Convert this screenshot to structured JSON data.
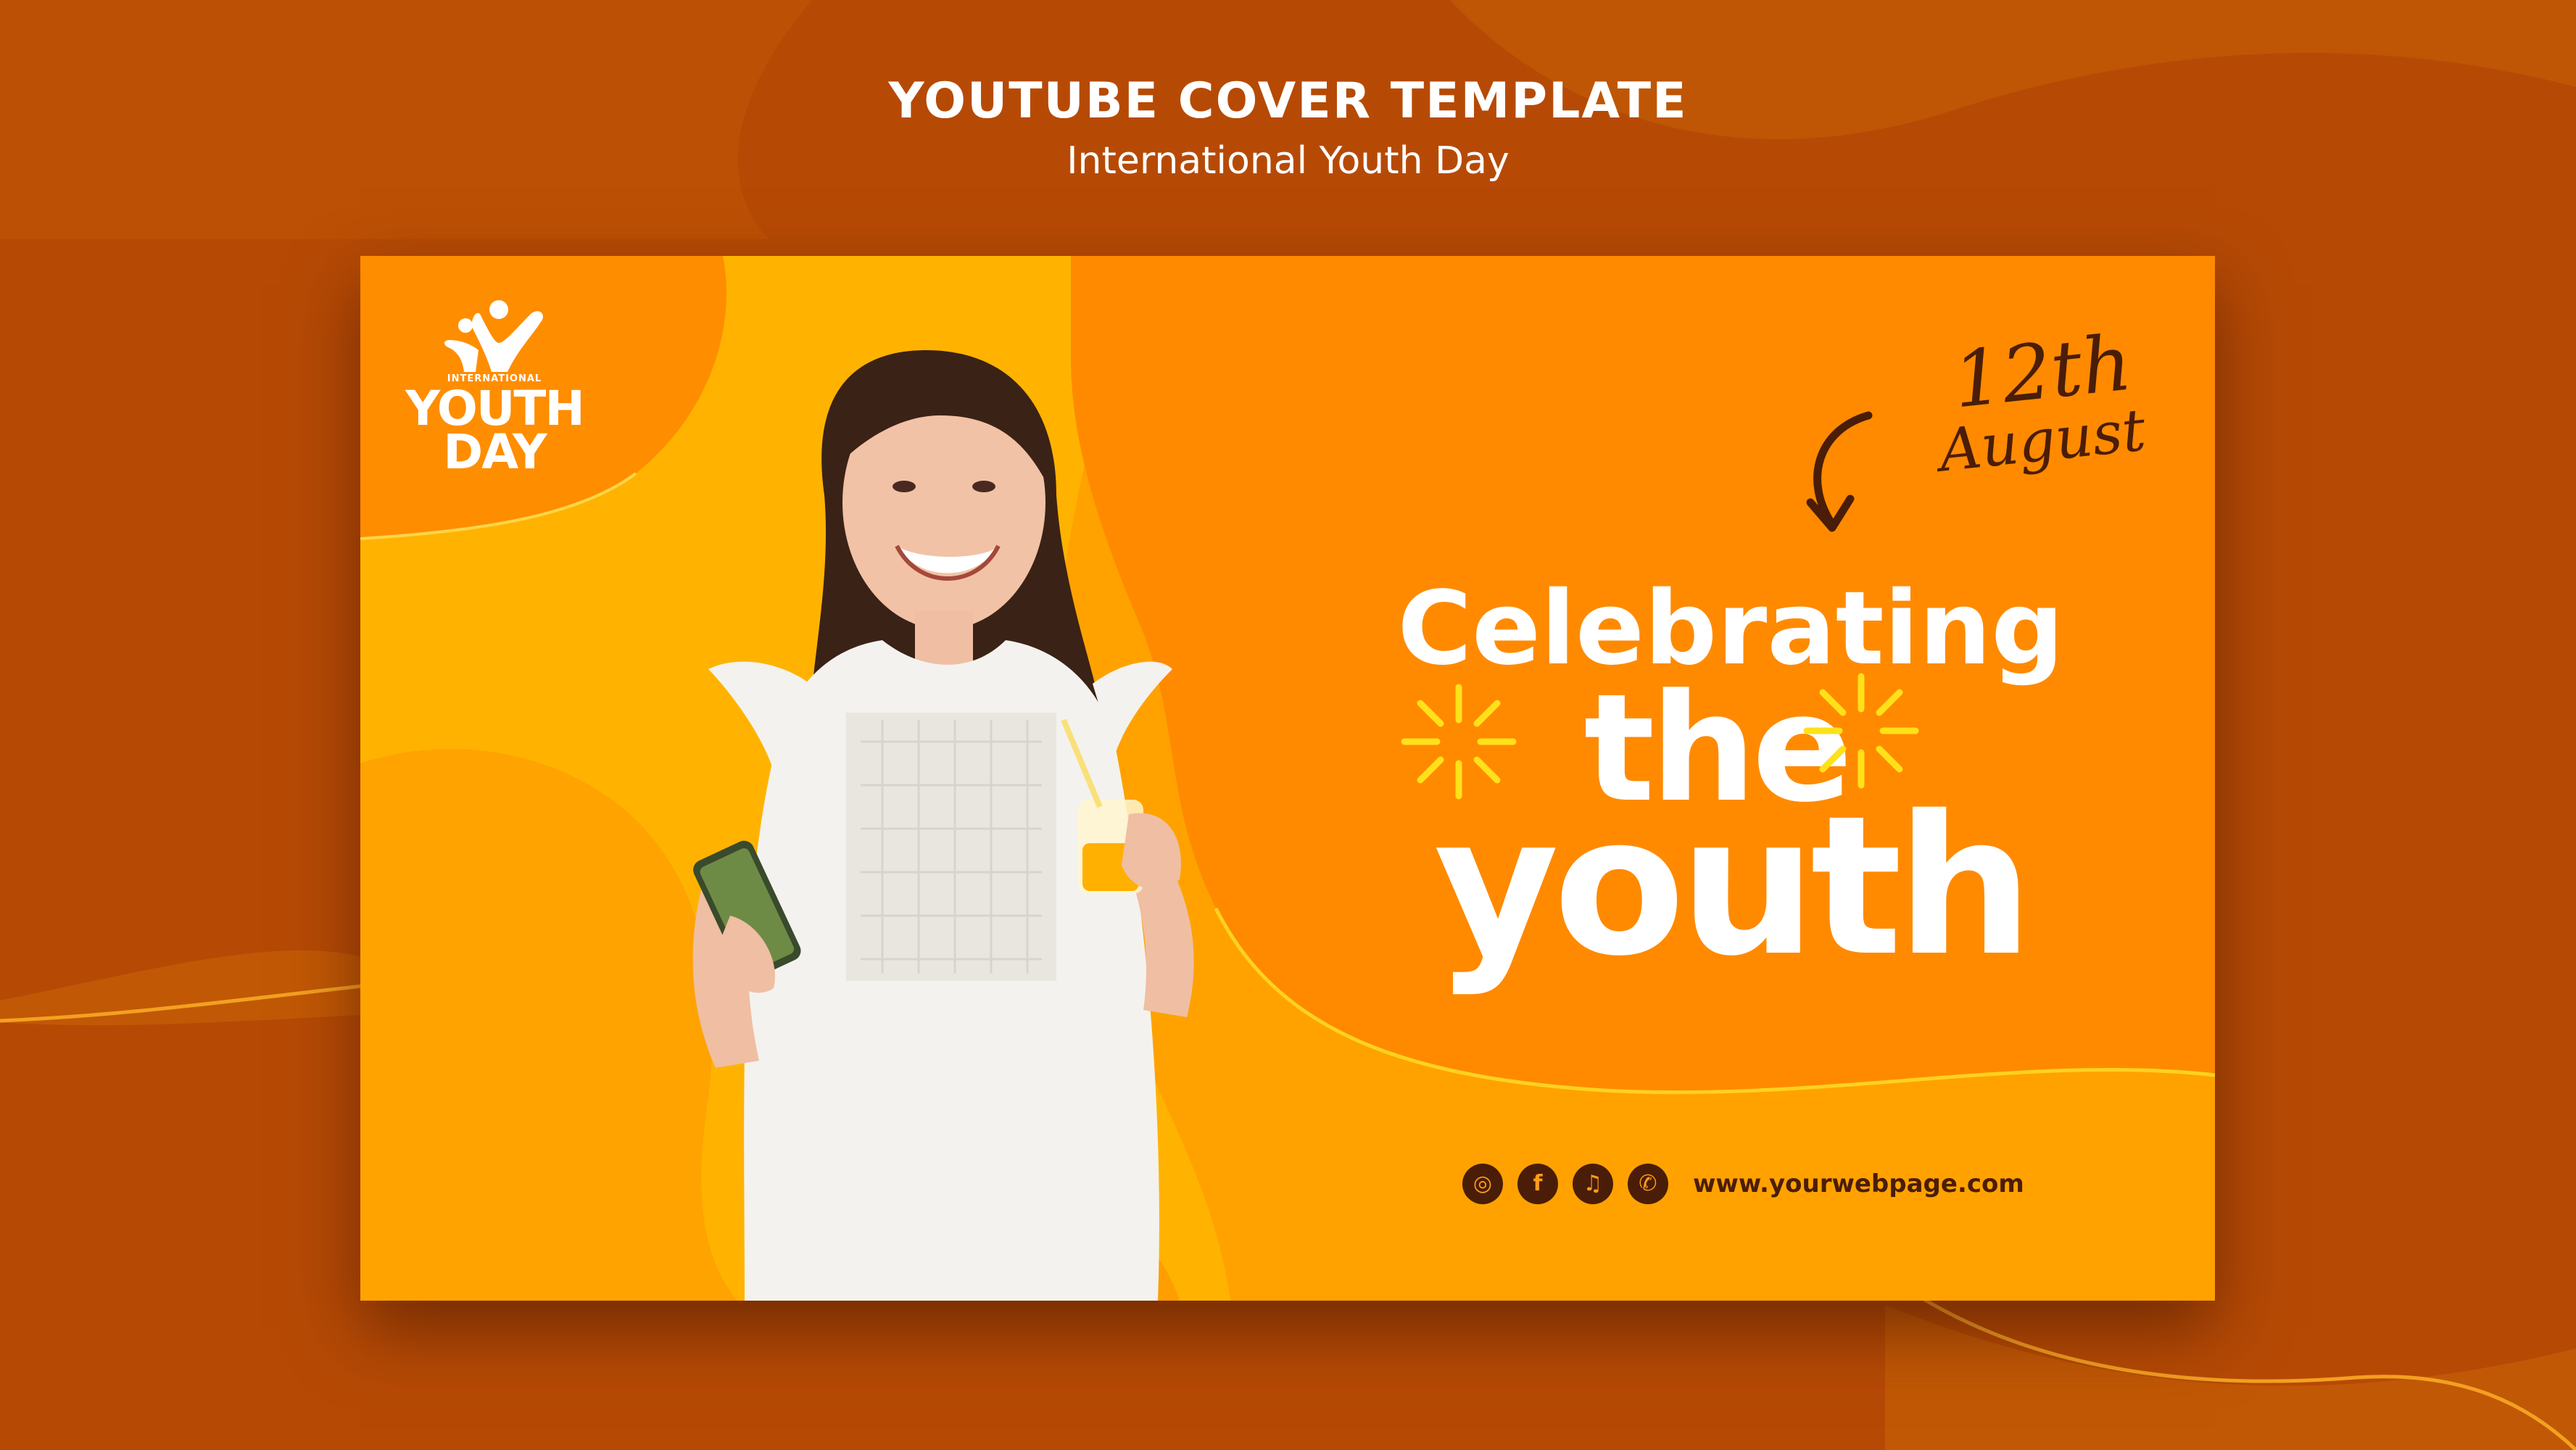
{
  "page": {
    "title": "YOUTUBE COVER TEMPLATE",
    "subtitle": "International Youth Day"
  },
  "cover": {
    "logo": {
      "small_text": "INTERNATIONAL",
      "big_line1": "YOUTH",
      "big_line2": "DAY"
    },
    "date": {
      "day": "12th",
      "month": "August"
    },
    "headline": {
      "line1": "Celebrating",
      "line2": "the",
      "line3": "youth"
    },
    "social": {
      "icons": [
        "instagram-icon",
        "facebook-icon",
        "twitter-icon",
        "whatsapp-icon"
      ],
      "icon_glyphs": [
        "◎",
        "f",
        "♫",
        "✆"
      ],
      "website": "www.yourwebpage.com"
    },
    "photo_subject": "smiling young woman holding phone and juice glass"
  },
  "colors": {
    "background": "#b94c04",
    "card_orange": "#ff8a00",
    "card_yellow": "#ffb300",
    "text_dark": "#4a1d08",
    "sparkle": "#ffe119",
    "white": "#ffffff"
  }
}
